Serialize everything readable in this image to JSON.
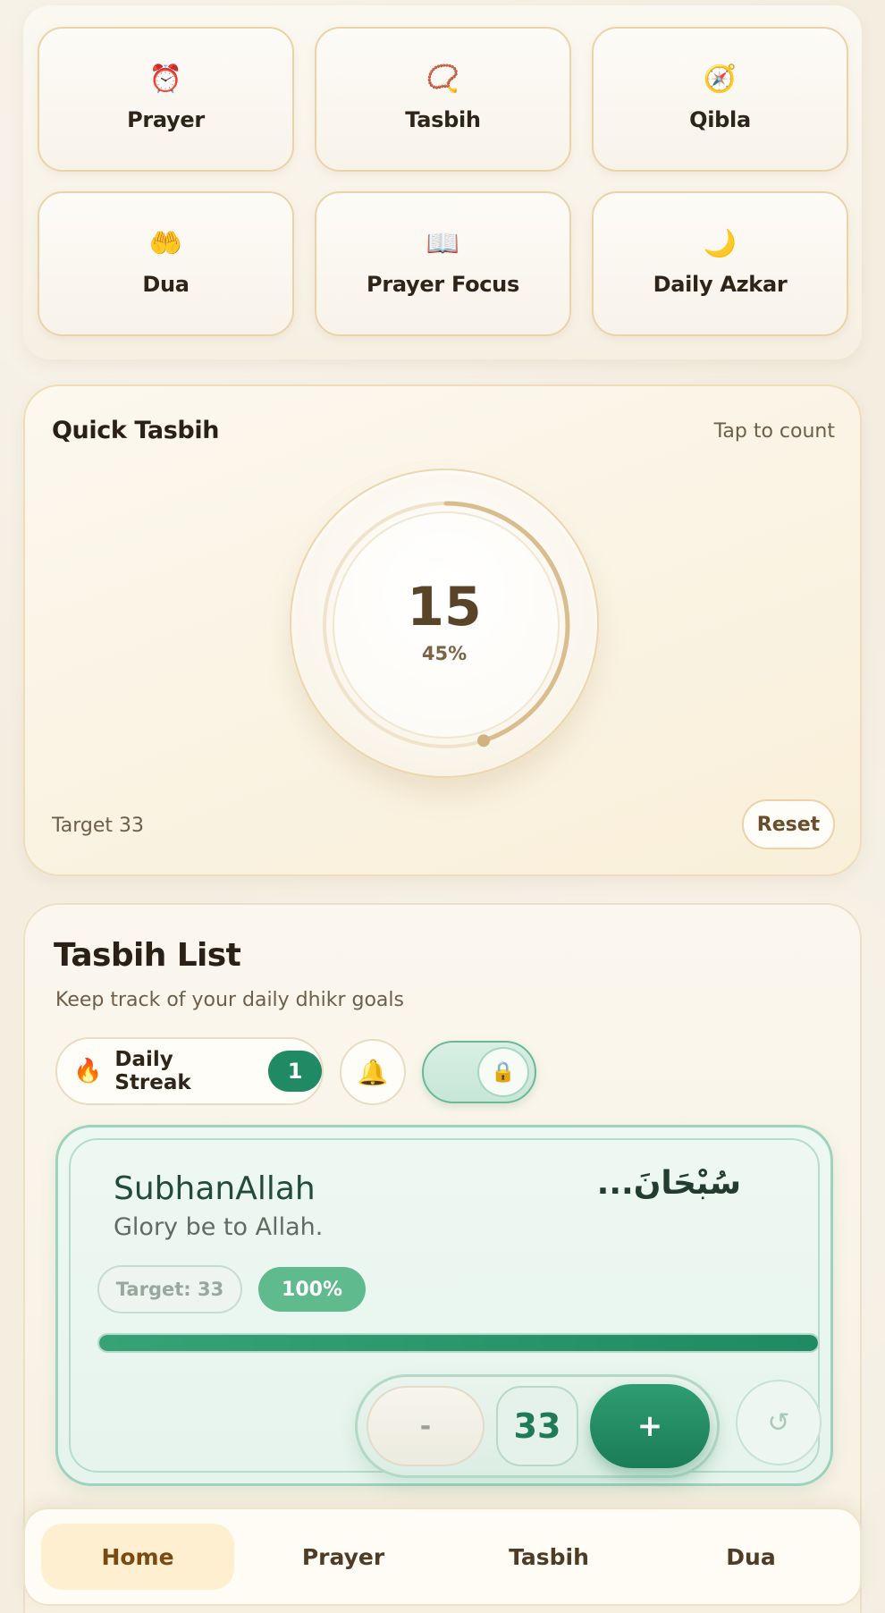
{
  "quick_actions": [
    {
      "icon": "⏰",
      "icon_name": "alarm-clock-icon",
      "label": "Prayer"
    },
    {
      "icon": "📿",
      "icon_name": "prayer-beads-icon",
      "label": "Tasbih"
    },
    {
      "icon": "🧭",
      "icon_name": "compass-icon",
      "label": "Qibla"
    },
    {
      "icon": "🤲",
      "icon_name": "palms-up-icon",
      "label": "Dua"
    },
    {
      "icon": "📖",
      "icon_name": "open-book-icon",
      "label": "Prayer Focus"
    },
    {
      "icon": "🌙",
      "icon_name": "crescent-moon-icon",
      "label": "Daily Azkar"
    }
  ],
  "quick_tasbih": {
    "title": "Quick Tasbih",
    "hint": "Tap to count",
    "count": "15",
    "progress_label": "45%",
    "progress": 0.45,
    "target_label": "Target 33",
    "reset_label": "Reset"
  },
  "tasbih_list": {
    "title": "Tasbih List",
    "subtitle": "Keep track of your daily dhikr goals",
    "streak": {
      "icon": "🔥",
      "label": "Daily Streak",
      "count": "1"
    },
    "bell_icon": "🔔",
    "lock_icon": "🔒",
    "items": [
      {
        "name": "SubhanAllah",
        "translation": "Glory be to Allah.",
        "arabic": "سُبْحَانَ...",
        "target_label": "Target: 33",
        "percent_label": "100%",
        "progress": 1.0,
        "minus_label": "-",
        "count": "33",
        "plus_label": "+",
        "undo_icon": "↺"
      }
    ]
  },
  "bottom_nav": [
    {
      "label": "Home",
      "active": true
    },
    {
      "label": "Prayer",
      "active": false
    },
    {
      "label": "Tasbih",
      "active": false
    },
    {
      "label": "Dua",
      "active": false
    }
  ],
  "colors": {
    "accent_green": "#1f8a63",
    "gold_border": "#ead3a8",
    "nav_active_bg": "#fdefcf",
    "background": "#f4eee1"
  }
}
